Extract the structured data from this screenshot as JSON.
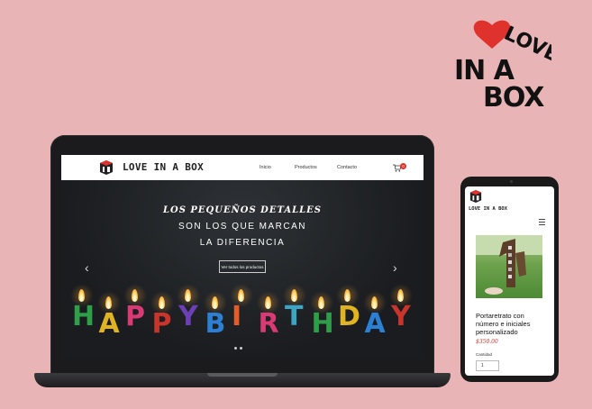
{
  "brand": {
    "name": "LOVE IN A BOX",
    "logo_top": "LOVE",
    "logo_mid": "IN A",
    "logo_bottom": "BOX"
  },
  "desktop": {
    "nav": [
      {
        "label": "Inicio"
      },
      {
        "label": "Productos"
      },
      {
        "label": "Contacto"
      }
    ],
    "cart_count": "0",
    "hero": {
      "line1": "LOS PEQUEÑOS DETALLES",
      "line2": "SON LOS QUE MARCAN",
      "line3": "LA DIFERENCIA",
      "button": "Ver todos los productos",
      "prev": "‹",
      "next": "›",
      "candle_letters": [
        "H",
        "A",
        "P",
        "P",
        "Y",
        "B",
        "I",
        "R",
        "T",
        "H",
        "D",
        "A",
        "Y"
      ]
    }
  },
  "mobile": {
    "product_title": "Portaretrato con número e iniciales personalizado",
    "price": "$350.00",
    "qty_label": "Cantidad",
    "qty_value": "1"
  },
  "colors": {
    "background": "#e8b4b6",
    "accent_red": "#e0322d",
    "candle_colors": [
      "#2f9e48",
      "#e0b323",
      "#d93a73",
      "#c9342b",
      "#6c3fb5",
      "#2b7fd4",
      "#e45c2a",
      "#d93a73",
      "#3aa5c4",
      "#2f9e48",
      "#e0b323",
      "#2b7fd4",
      "#c9342b"
    ]
  },
  "icons": [
    "heart-icon",
    "cart-icon",
    "chevron-left-icon",
    "chevron-right-icon",
    "menu-icon",
    "box-logo-icon"
  ]
}
